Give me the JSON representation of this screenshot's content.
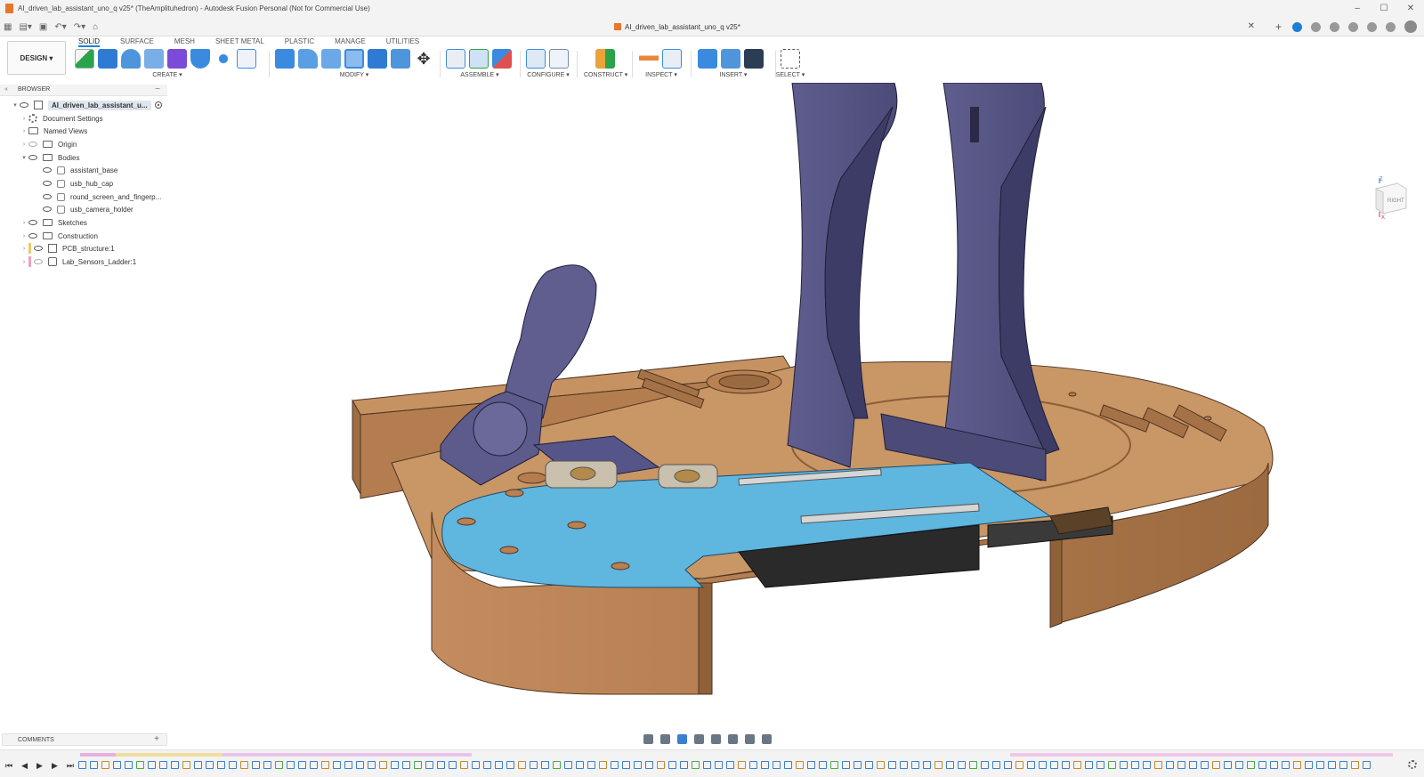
{
  "window": {
    "title": "AI_driven_lab_assistant_uno_q v25* (TheAmplituhedron) - Autodesk Fusion Personal (Not for Commercial Use)"
  },
  "tab": {
    "document_name": "AI_driven_lab_assistant_uno_q v25*"
  },
  "toolbar": {
    "workspace": "DESIGN",
    "tabs": [
      "SOLID",
      "SURFACE",
      "MESH",
      "SHEET METAL",
      "PLASTIC",
      "MANAGE",
      "UTILITIES"
    ],
    "active_tab": "SOLID",
    "groups": {
      "create": "CREATE",
      "modify": "MODIFY",
      "assemble": "ASSEMBLE",
      "configure": "CONFIGURE",
      "construct": "CONSTRUCT",
      "inspect": "INSPECT",
      "insert": "INSERT",
      "select": "SELECT"
    }
  },
  "browser": {
    "title": "BROWSER",
    "root": "AI_driven_lab_assistant_u...",
    "items": {
      "document_settings": "Document Settings",
      "named_views": "Named Views",
      "origin": "Origin",
      "bodies": "Bodies",
      "body1": "assistant_base",
      "body2": "usb_hub_cap",
      "body3": "round_screen_and_fingerp...",
      "body4": "usb_camera_holder",
      "sketches": "Sketches",
      "construction": "Construction",
      "pcb": "PCB_structure:1",
      "sensors": "Lab_Sensors_Ladder:1"
    }
  },
  "viewcube": {
    "face": "RIGHT",
    "z_axis": "Z",
    "x_axis": "X"
  },
  "comments": {
    "label": "COMMENTS"
  },
  "colors": {
    "accent": "#1d7fd6",
    "base_wood": "#b98052",
    "purple_parts": "#5a5987",
    "pcb_blue": "#5fb6df"
  }
}
